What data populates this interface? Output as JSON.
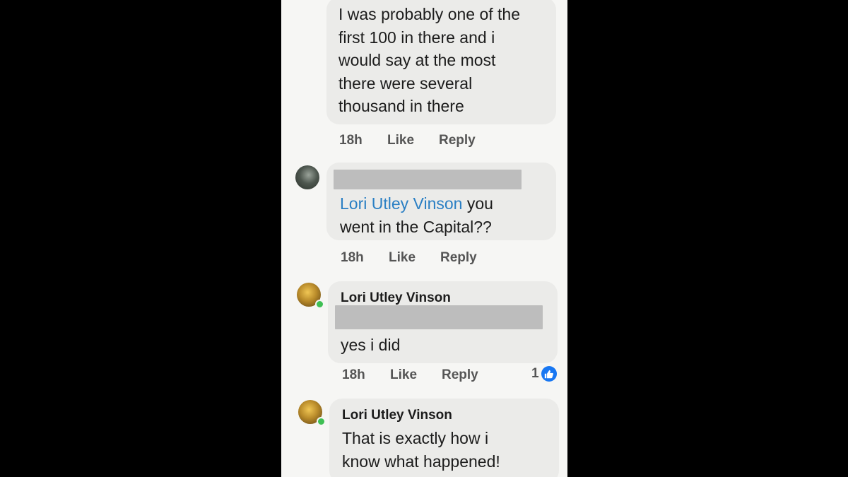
{
  "comments": [
    {
      "text": "I was probably one of the\nfirst 100 in there and i\nwould say at the most\nthere were several\nthousand in there",
      "actions": {
        "time": "18h",
        "like": "Like",
        "reply": "Reply"
      }
    },
    {
      "mention": "Lori Utley Vinson",
      "text": " you\nwent in the Capital??",
      "actions": {
        "time": "18h",
        "like": "Like",
        "reply": "Reply"
      }
    },
    {
      "author": "Lori Utley Vinson",
      "text": "yes i did",
      "actions": {
        "time": "18h",
        "like": "Like",
        "reply": "Reply"
      },
      "reaction_count": "1"
    },
    {
      "author": "Lori Utley Vinson",
      "text": "That is exactly how i\nknow what happened!"
    }
  ],
  "colors": {
    "mention": "#2a7fc4",
    "like_badge": "#1877f2",
    "online_dot": "#3fbf54"
  },
  "icons": {
    "reaction": "like-thumb-icon"
  }
}
